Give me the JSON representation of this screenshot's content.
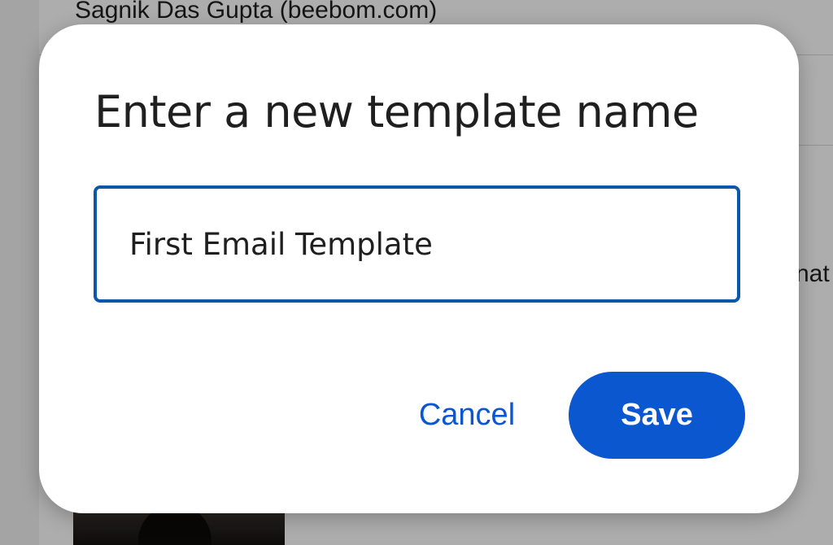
{
  "background": {
    "sender_text": "Sagnik Das Gupta (beebom.com)",
    "side_text": "nat"
  },
  "dialog": {
    "title": "Enter a new template name",
    "input": {
      "value": "First Email Template",
      "placeholder": ""
    },
    "cancel_label": "Cancel",
    "save_label": "Save"
  },
  "colors": {
    "accent": "#0b57d0",
    "input_border": "#0b57a8",
    "scrim": "#c7c7c7"
  }
}
